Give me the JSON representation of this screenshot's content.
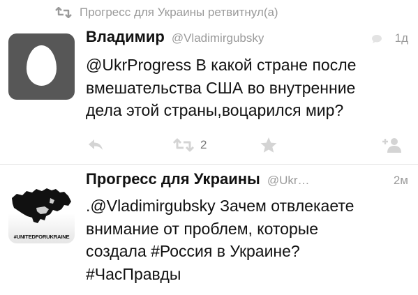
{
  "retweet_banner": {
    "text": "Прогресс для Украины ретвитнул(а)",
    "icon": "retweet-icon"
  },
  "tweets": [
    {
      "author_name": "Владимир",
      "author_handle": "@Vladimirgubsky",
      "time": "1д",
      "text": "@UkrProgress В какой стране после\nвмешательства США во внутренние\nдела этой страны,воцарился мир?",
      "avatar": "egg-avatar",
      "actions": {
        "reply_icon": "reply-icon",
        "retweet_icon": "retweet-icon",
        "retweet_count": "2",
        "favorite_icon": "star-icon",
        "follow_icon": "add-user-icon"
      }
    },
    {
      "author_name": "Прогресс для Украины",
      "author_handle": "@Ukr…",
      "time": "2м",
      "text": ".@Vladimirgubsky Зачем отвлекаете\nвнимание от проблем, которые\nсоздала #Россия в Украине?\n#ЧасПравды",
      "avatar": "united-for-ukraine-avatar",
      "avatar_text": "#UNITEDFORUKRAINE"
    }
  ],
  "colors": {
    "text": "#111111",
    "secondary": "#9a9a9a",
    "action_icon": "#d4d4d4",
    "divider": "#e3e3e3",
    "avatar_egg_bg": "#575757"
  }
}
